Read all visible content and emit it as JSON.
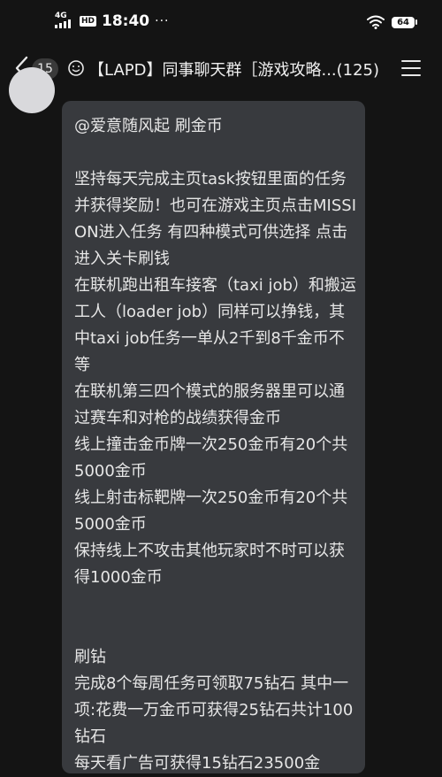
{
  "status_bar": {
    "network": "4G",
    "hd": "HD",
    "time": "18:40",
    "dots": "···",
    "battery": "64"
  },
  "nav": {
    "unread_count": "15",
    "title": "【LAPD】同事聊天群［游戏攻略...(125)"
  },
  "message": {
    "text": "@爱意随风起 刷金币\n\n坚持每天完成主页task按钮里面的任务并获得奖励！也可在游戏主页点击MISSION进入任务 有四种模式可供选择 点击进入关卡刷钱\n在联机跑出租车接客（taxi job）和搬运工人（loader job）同样可以挣钱，其中taxi job任务一单从2千到8千金币不等\n在联机第三四个模式的服务器里可以通过赛车和对枪的战绩获得金币\n线上撞击金币牌一次250金币有20个共5000金币\n线上射击标靶牌一次250金币有20个共5000金币\n保持线上不攻击其他玩家时不时可以获得1000金币\n\n\n刷钻\n完成8个每周任务可领取75钻石 其中一项:花费一万金币可获得25钻石共计100钻石\n每天看广告可获得15钻石23500金"
  },
  "colors": {
    "background": "#141414",
    "bubble": "#383a3e",
    "text": "#e6e6e6",
    "avatar": "#d9d9dc"
  }
}
